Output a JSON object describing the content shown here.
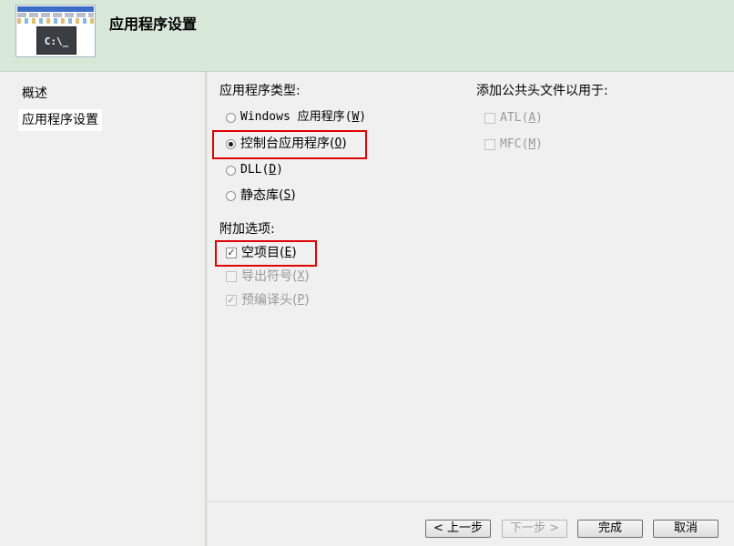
{
  "header": {
    "title": "应用程序设置",
    "icon_text": "C:\\_"
  },
  "sidebar": {
    "items": [
      {
        "label": "概述"
      },
      {
        "label": "应用程序设置"
      }
    ]
  },
  "app_type": {
    "label": "应用程序类型:",
    "options": [
      {
        "text": "Windows 应用程序(",
        "accel": "W",
        "suffix": ")",
        "checked": false
      },
      {
        "text": "控制台应用程序(",
        "accel": "O",
        "suffix": ")",
        "checked": true
      },
      {
        "text": "DLL(",
        "accel": "D",
        "suffix": ")",
        "checked": false
      },
      {
        "text": "静态库(",
        "accel": "S",
        "suffix": ")",
        "checked": false
      }
    ]
  },
  "common_headers": {
    "label": "添加公共头文件以用于:",
    "options": [
      {
        "text": "ATL(",
        "accel": "A",
        "suffix": ")",
        "checked": false
      },
      {
        "text": "MFC(",
        "accel": "M",
        "suffix": ")",
        "checked": false
      }
    ]
  },
  "additional": {
    "label": "附加选项:",
    "options": [
      {
        "text": "空项目(",
        "accel": "E",
        "suffix": ")",
        "checked": true
      },
      {
        "text": "导出符号(",
        "accel": "X",
        "suffix": ")",
        "checked": false
      },
      {
        "text": "预编译头(",
        "accel": "P",
        "suffix": ")",
        "checked": true
      }
    ]
  },
  "buttons": {
    "back": "< 上一步",
    "next": "下一步 >",
    "finish": "完成",
    "cancel": "取消"
  },
  "colors": {
    "header_bg": "#d8e8d8",
    "highlight": "#e00000"
  }
}
